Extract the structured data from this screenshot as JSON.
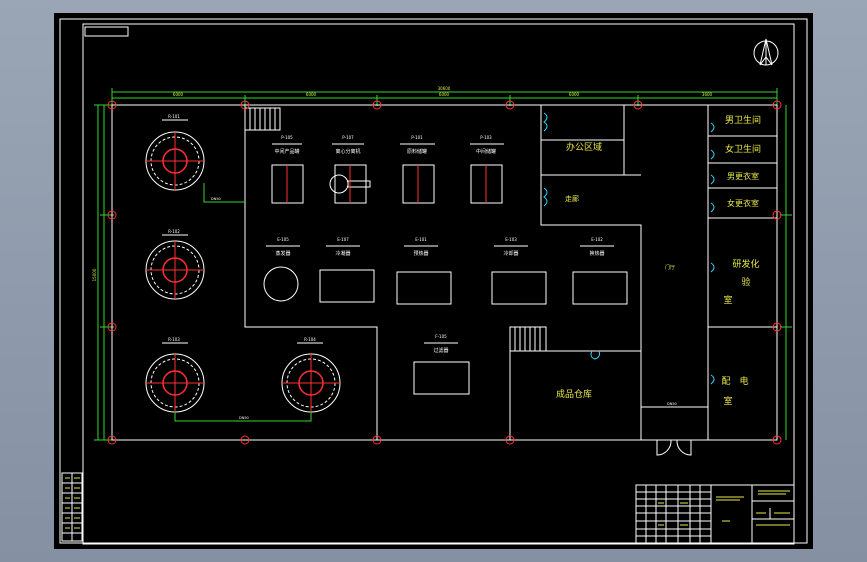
{
  "drawing": {
    "colors": {
      "background": "#000000",
      "wall": "#ffffff",
      "column": "#ff3030",
      "dimension": "#30d830",
      "door": "#30d8ff",
      "label": "#e8e84a"
    },
    "dimensions": {
      "overall": "30600",
      "top_segments": [
        "6000",
        "6000",
        "6000",
        "6000",
        "3600"
      ],
      "left_total": "15000"
    },
    "rooms": {
      "office": "办公区域",
      "corridor": "走廊",
      "mens_toilet": "男卫生间",
      "womens_toilet": "女卫生间",
      "locker_1": "男更衣室",
      "locker_2": "女更衣室",
      "lab_1": "研发化",
      "lab_2": "验",
      "lab_3": "室",
      "warehouse": "成品仓库",
      "power_1": "配",
      "power_2": "电",
      "power_3": "室",
      "hall": "门厅"
    },
    "reactors": [
      {
        "tag": "R-101"
      },
      {
        "tag": "R-102"
      },
      {
        "tag": "R-103"
      },
      {
        "tag": "R-104"
      }
    ],
    "equipment_row1": [
      {
        "tag": "P-105",
        "desc": "中间产品罐"
      },
      {
        "tag": "P-107",
        "desc": "离心分离机"
      },
      {
        "tag": "P-101",
        "desc": "原料储罐"
      },
      {
        "tag": "P-103",
        "desc": "中间储罐"
      }
    ],
    "equipment_row2": [
      {
        "tag": "E-105",
        "desc": "蒸发器"
      },
      {
        "tag": "E-107",
        "desc": "冷凝器"
      },
      {
        "tag": "E-101",
        "desc": "预热器"
      },
      {
        "tag": "E-103",
        "desc": "冷却器"
      },
      {
        "tag": "E-102",
        "desc": "换热器"
      }
    ],
    "equipment_row3": [
      {
        "tag": "F-105",
        "desc": "过滤器"
      }
    ],
    "pipes": [
      "DN50",
      "DN50",
      "DN50"
    ],
    "north_arrow": "north-arrow-icon"
  }
}
